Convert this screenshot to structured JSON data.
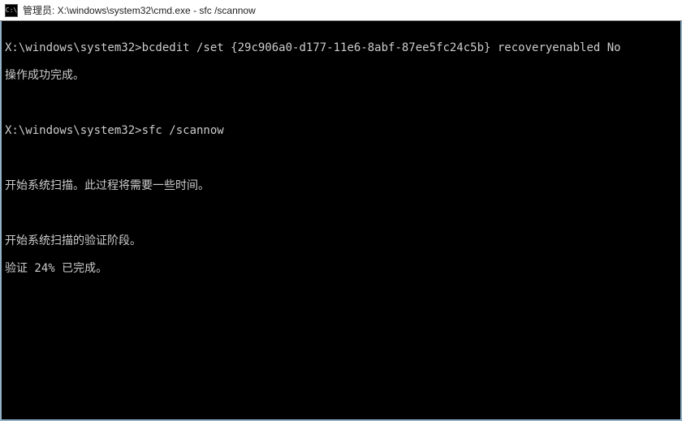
{
  "titlebar": {
    "icon_label": "C:\\",
    "title": "管理员: X:\\windows\\system32\\cmd.exe - sfc  /scannow"
  },
  "console": {
    "prompt1": "X:\\windows\\system32>",
    "cmd1": "bcdedit /set {29c906a0-d177-11e6-8abf-87ee5fc24c5b} recoveryenabled No",
    "result1": "操作成功完成。",
    "prompt2": "X:\\windows\\system32>",
    "cmd2": "sfc /scannow",
    "msg1": "开始系统扫描。此过程将需要一些时间。",
    "msg2": "开始系统扫描的验证阶段。",
    "msg3": "验证 24% 已完成。"
  }
}
